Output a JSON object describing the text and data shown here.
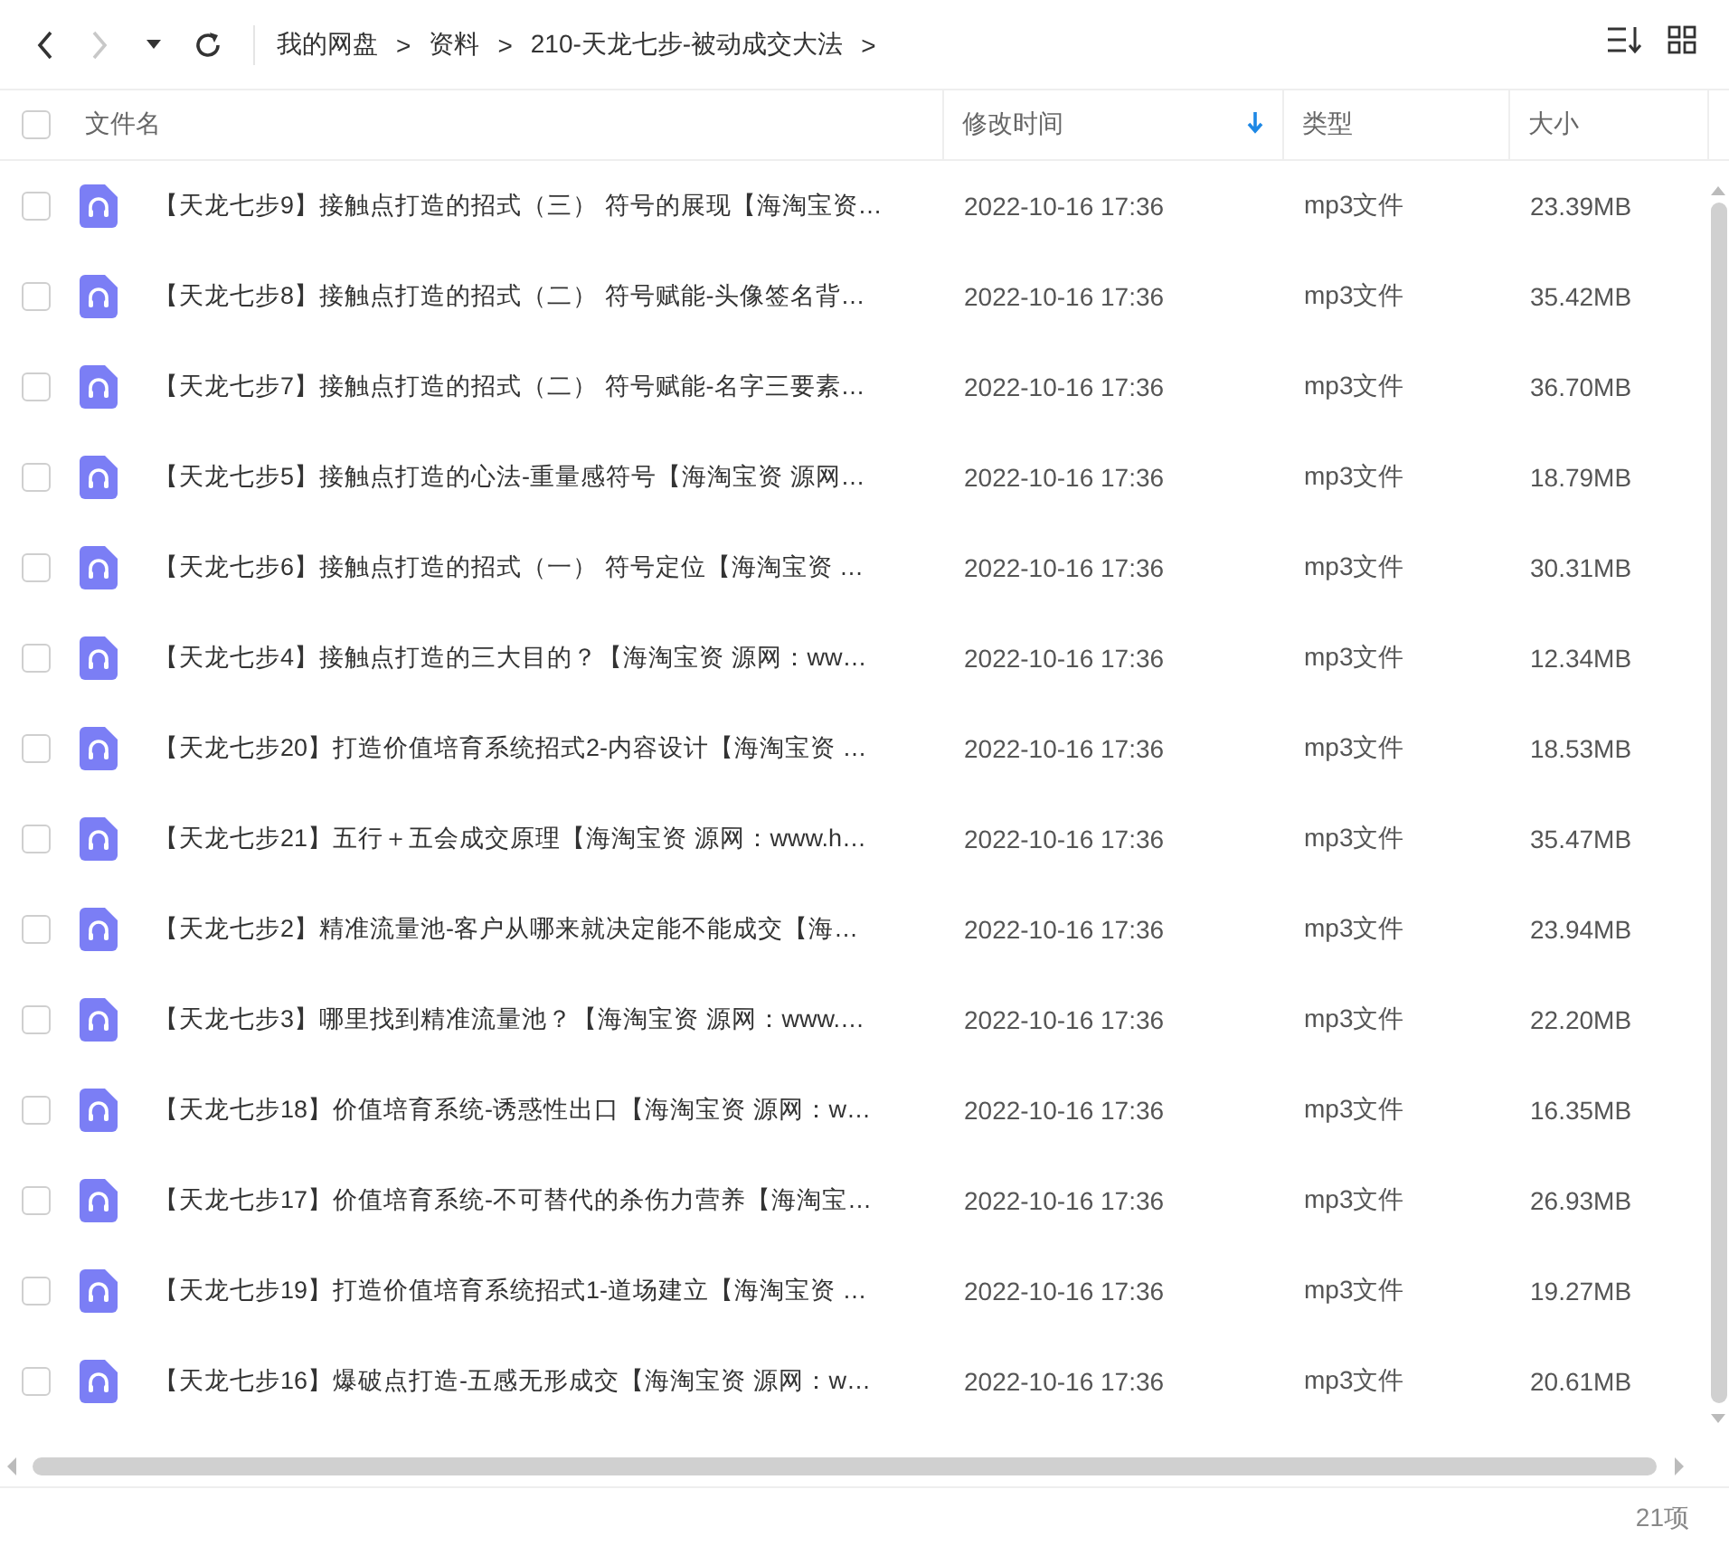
{
  "toolbar": {
    "nav": [
      {
        "kind": "back",
        "disabled": false
      },
      {
        "kind": "forward",
        "disabled": true
      },
      {
        "kind": "dropdown",
        "disabled": false
      },
      {
        "kind": "refresh",
        "disabled": false
      }
    ],
    "breadcrumb": {
      "items": [
        "我的网盘",
        "资料",
        "210-天龙七步-被动成交大法"
      ],
      "separator": ">"
    }
  },
  "table": {
    "select_all": {
      "checked": false
    },
    "columns": [
      {
        "label": "文件名",
        "sorted": false
      },
      {
        "label": "修改时间",
        "sorted": true
      },
      {
        "label": "类型",
        "sorted": false
      },
      {
        "label": "大小",
        "sorted": false
      }
    ],
    "rows": [
      {
        "name": "【天龙七步9】接触点打造的招式（三） 符号的展现【海淘宝资…",
        "modified": "2022-10-16 17:36",
        "type": "mp3文件",
        "size": "23.39MB",
        "checked": false
      },
      {
        "name": "【天龙七步8】接触点打造的招式（二） 符号赋能-头像签名背…",
        "modified": "2022-10-16 17:36",
        "type": "mp3文件",
        "size": "35.42MB",
        "checked": false
      },
      {
        "name": "【天龙七步7】接触点打造的招式（二） 符号赋能-名字三要素…",
        "modified": "2022-10-16 17:36",
        "type": "mp3文件",
        "size": "36.70MB",
        "checked": false
      },
      {
        "name": "【天龙七步5】接触点打造的心法-重量感符号【海淘宝资 源网…",
        "modified": "2022-10-16 17:36",
        "type": "mp3文件",
        "size": "18.79MB",
        "checked": false
      },
      {
        "name": "【天龙七步6】接触点打造的招式（一） 符号定位【海淘宝资 …",
        "modified": "2022-10-16 17:36",
        "type": "mp3文件",
        "size": "30.31MB",
        "checked": false
      },
      {
        "name": "【天龙七步4】接触点打造的三大目的？【海淘宝资 源网：ww…",
        "modified": "2022-10-16 17:36",
        "type": "mp3文件",
        "size": "12.34MB",
        "checked": false
      },
      {
        "name": "【天龙七步20】打造价值培育系统招式2-内容设计【海淘宝资 …",
        "modified": "2022-10-16 17:36",
        "type": "mp3文件",
        "size": "18.53MB",
        "checked": false
      },
      {
        "name": "【天龙七步21】五行＋五会成交原理【海淘宝资 源网：www.h…",
        "modified": "2022-10-16 17:36",
        "type": "mp3文件",
        "size": "35.47MB",
        "checked": false
      },
      {
        "name": "【天龙七步2】精准流量池-客户从哪来就决定能不能成交【海…",
        "modified": "2022-10-16 17:36",
        "type": "mp3文件",
        "size": "23.94MB",
        "checked": false
      },
      {
        "name": "【天龙七步3】哪里找到精准流量池？【海淘宝资 源网：www.…",
        "modified": "2022-10-16 17:36",
        "type": "mp3文件",
        "size": "22.20MB",
        "checked": false
      },
      {
        "name": "【天龙七步18】价值培育系统-诱惑性出口【海淘宝资 源网：w…",
        "modified": "2022-10-16 17:36",
        "type": "mp3文件",
        "size": "16.35MB",
        "checked": false
      },
      {
        "name": "【天龙七步17】价值培育系统-不可替代的杀伤力营养【海淘宝…",
        "modified": "2022-10-16 17:36",
        "type": "mp3文件",
        "size": "26.93MB",
        "checked": false
      },
      {
        "name": "【天龙七步19】打造价值培育系统招式1-道场建立【海淘宝资 …",
        "modified": "2022-10-16 17:36",
        "type": "mp3文件",
        "size": "19.27MB",
        "checked": false
      },
      {
        "name": "【天龙七步16】爆破点打造-五感无形成交【海淘宝资 源网：w…",
        "modified": "2022-10-16 17:36",
        "type": "mp3文件",
        "size": "20.61MB",
        "checked": false
      }
    ]
  },
  "status_bar": {
    "count": "21项"
  }
}
